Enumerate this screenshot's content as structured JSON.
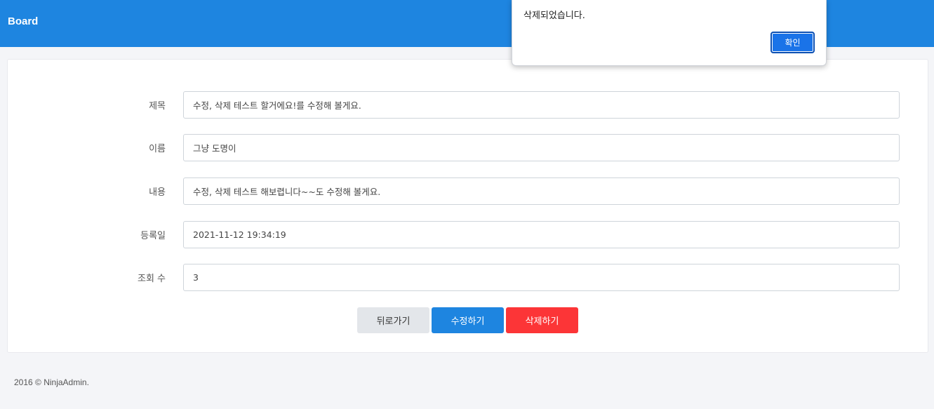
{
  "header": {
    "brand": "Board",
    "color": "#1e85e0"
  },
  "form": {
    "fields": [
      {
        "label": "제목",
        "value": "수정, 삭제 테스트 할거에요!를 수정해 볼게요."
      },
      {
        "label": "이름",
        "value": "그냥 도명이"
      },
      {
        "label": "내용",
        "value": "수정, 삭제 테스트 해보렵니다~~도 수정해 볼게요."
      },
      {
        "label": "등록일",
        "value": "2021-11-12 19:34:19"
      },
      {
        "label": "조회 수",
        "value": "3"
      }
    ]
  },
  "buttons": {
    "back": "뒤로가기",
    "edit": "수정하기",
    "delete": "삭제하기",
    "back_color": "#e3e6ea",
    "edit_color": "#1e85e0",
    "delete_color": "#fc3537"
  },
  "footer": {
    "text": "2016 © NinjaAdmin."
  },
  "dialog": {
    "message": "삭제되었습니다.",
    "ok_label": "확인"
  }
}
